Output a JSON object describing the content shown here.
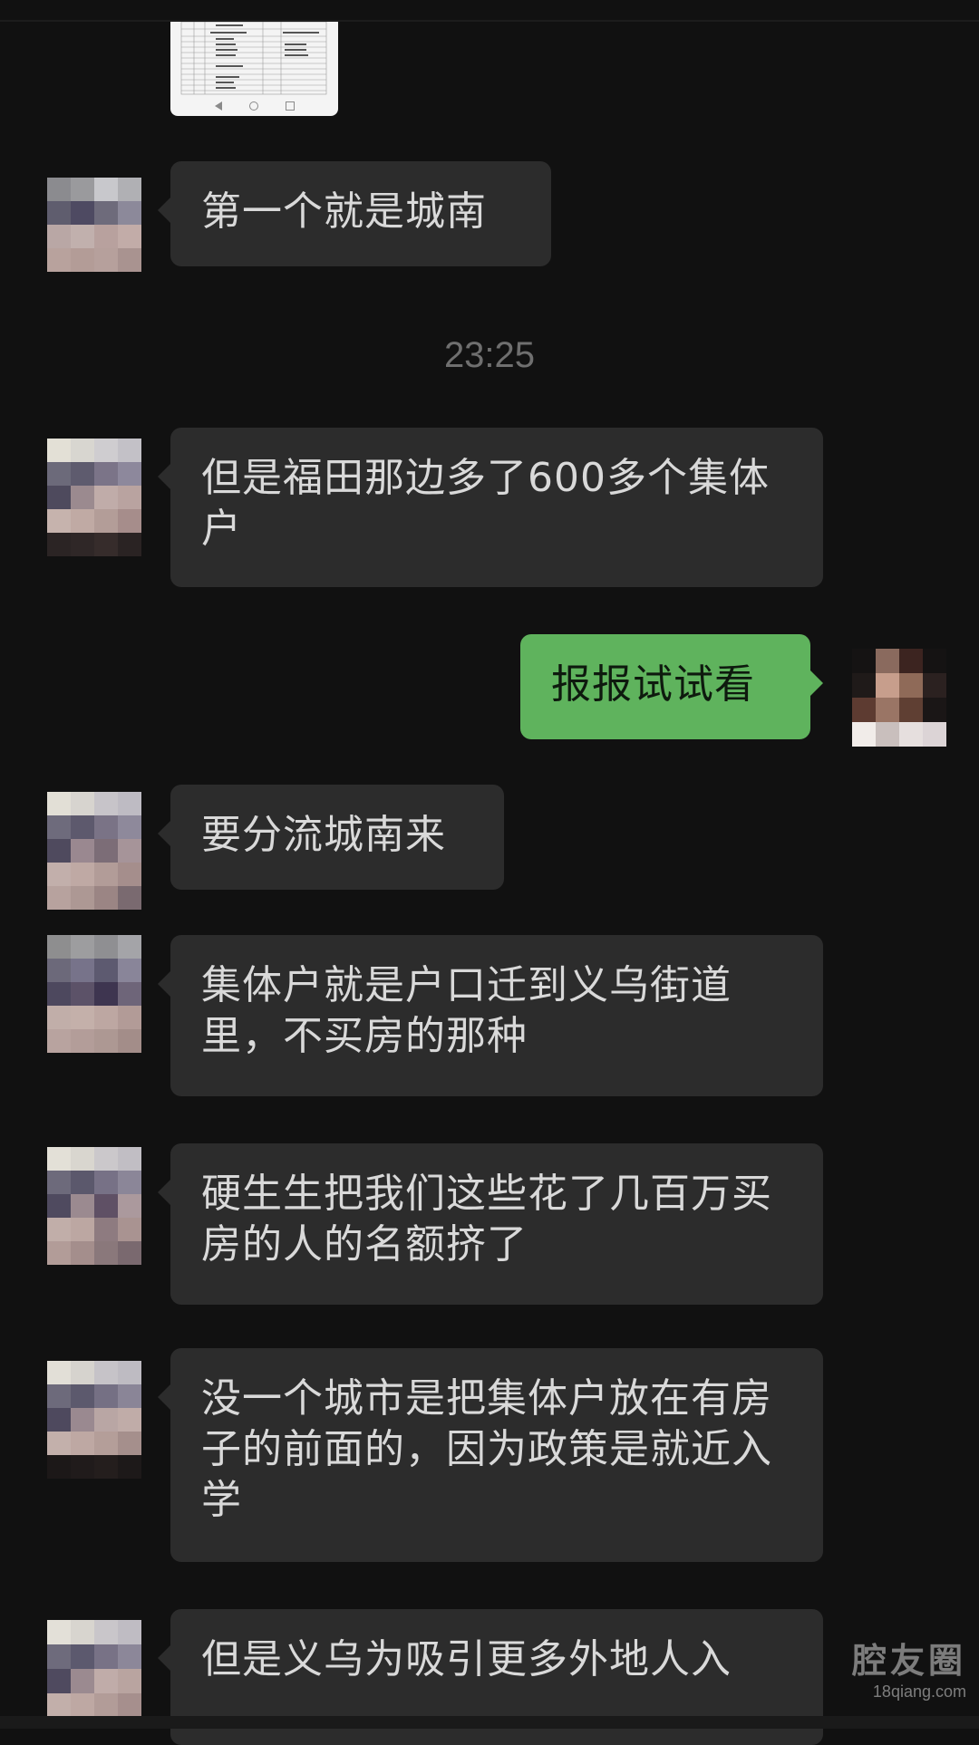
{
  "chat": {
    "timestamp": "23:25",
    "messages": [
      {
        "sender": "other",
        "text": "第一个就是城南"
      },
      {
        "sender": "other",
        "text": "但是福田那边多了600多个集体户"
      },
      {
        "sender": "self",
        "text": "报报试试看"
      },
      {
        "sender": "other",
        "text": "要分流城南来"
      },
      {
        "sender": "other",
        "text": "集体户就是户口迁到义乌街道里，不买房的那种"
      },
      {
        "sender": "other",
        "text": "硬生生把我们这些花了几百万买房的人的名额挤了"
      },
      {
        "sender": "other",
        "text": "没一个城市是把集体户放在有房子的前面的，因为政策是就近入学"
      },
      {
        "sender": "other",
        "text": "但是义乌为吸引更多外地人入"
      }
    ]
  },
  "watermark": {
    "logo": "腔友圈",
    "url": "18qiang.com"
  },
  "colors": {
    "background": "#111111",
    "bubble_other": "#2c2c2c",
    "bubble_self": "#5fb35d",
    "timestamp": "#6f6f6f"
  },
  "icons": [
    "back-nav-icon",
    "home-nav-icon",
    "recents-nav-icon"
  ]
}
